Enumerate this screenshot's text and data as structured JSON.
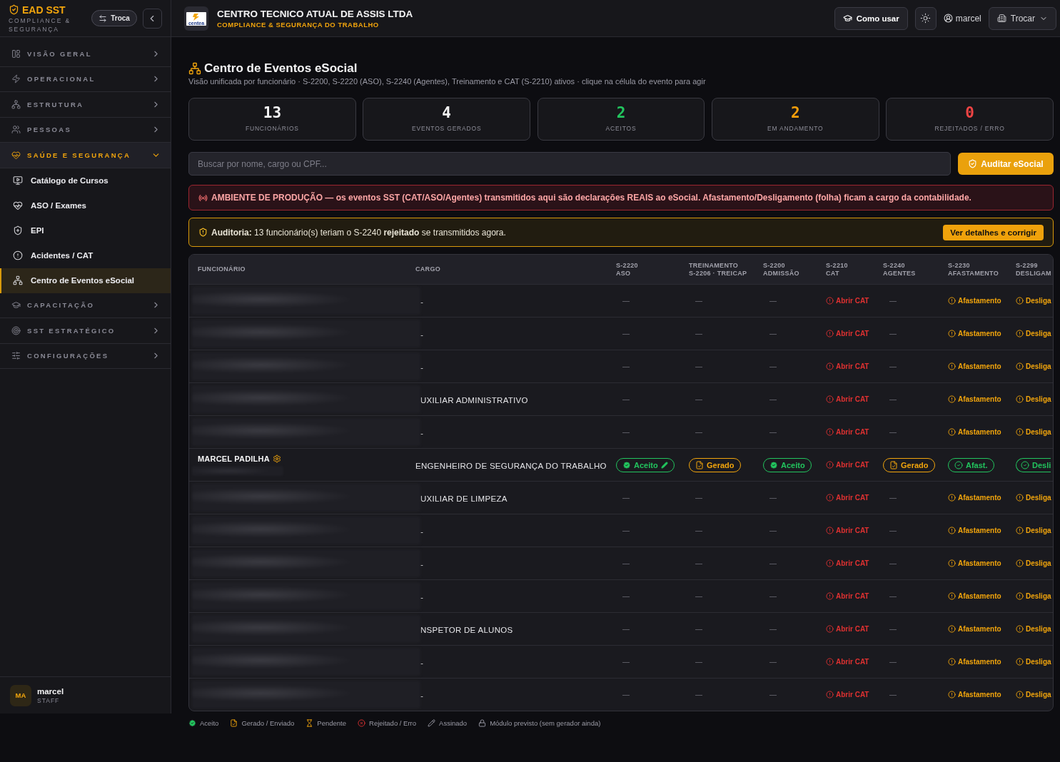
{
  "sidebar": {
    "brand": {
      "name": "EAD SST",
      "tagline": "COMPLIANCE & SEGURANÇA"
    },
    "switch_button": "Troca",
    "groups": [
      {
        "label": "VISÃO GERAL",
        "expanded": false
      },
      {
        "label": "OPERACIONAL",
        "expanded": false
      },
      {
        "label": "ESTRUTURA",
        "expanded": false
      },
      {
        "label": "PESSOAS",
        "expanded": false
      },
      {
        "label": "SAÚDE E SEGURANÇA",
        "expanded": true,
        "children": [
          {
            "label": "Catálogo de Cursos",
            "selected": false
          },
          {
            "label": "ASO / Exames",
            "selected": false
          },
          {
            "label": "EPI",
            "selected": false
          },
          {
            "label": "Acidentes / CAT",
            "selected": false
          },
          {
            "label": "Centro de Eventos eSocial",
            "selected": true
          }
        ]
      },
      {
        "label": "CAPACITAÇÃO",
        "expanded": false
      },
      {
        "label": "SST ESTRATÉGICO",
        "expanded": false
      },
      {
        "label": "CONFIGURAÇÕES",
        "expanded": false
      }
    ],
    "user": {
      "initials": "MA",
      "name": "marcel",
      "role": "STAFF"
    }
  },
  "header": {
    "logo_text": "centea",
    "company": "CENTRO TECNICO ATUAL DE ASSIS LTDA",
    "tagline": "COMPLIANCE & SEGURANÇA DO TRABALHO",
    "help_button": "Como usar",
    "user": "marcel",
    "switch_button": "Trocar"
  },
  "page": {
    "title": "Centro de Eventos eSocial",
    "subtitle": "Visão unificada por funcionário · S-2200, S-2220 (ASO), S-2240 (Agentes), Treinamento e CAT (S-2210) ativos · clique na célula do evento para agir"
  },
  "stats": [
    {
      "value": "13",
      "label": "FUNCIONÁRIOS",
      "color": "#f4f4f5"
    },
    {
      "value": "4",
      "label": "EVENTOS GERADOS",
      "color": "#f4f4f5"
    },
    {
      "value": "2",
      "label": "ACEITOS",
      "color": "#22c55e"
    },
    {
      "value": "2",
      "label": "EM ANDAMENTO",
      "color": "#f59e0b"
    },
    {
      "value": "0",
      "label": "REJEITADOS / ERRO",
      "color": "#ef4444"
    }
  ],
  "search": {
    "placeholder": "Buscar por nome, cargo ou CPF..."
  },
  "audit_button": "Auditar eSocial",
  "production_notice": "AMBIENTE DE PRODUÇÃO — os eventos SST (CAT/ASO/Agentes) transmitidos aqui são declarações REAIS ao eSocial. Afastamento/Desligamento (folha) ficam a cargo da contabilidade.",
  "audit_notice": {
    "text": "**Auditoria:** 13 funcionário(s) teriam o S-2240 **rejeitado** se transmitidos agora.",
    "button": "Ver detalhes e corrigir"
  },
  "table": {
    "columns": [
      {
        "title": "FUNCIONÁRIO"
      },
      {
        "title": "CARGO"
      },
      {
        "title": "S-2220",
        "subtitle": "ASO"
      },
      {
        "title": "TREINAMENTO",
        "subtitle": "S-2206 · TREICAP"
      },
      {
        "title": "S-2200",
        "subtitle": "ADMISSÃO"
      },
      {
        "title": "S-2210",
        "subtitle": "CAT"
      },
      {
        "title": "S-2240",
        "subtitle": "AGENTES"
      },
      {
        "title": "S-2230",
        "subtitle": "AFASTAMENTO"
      },
      {
        "title": "S-2299",
        "subtitle": "DESLIGAM"
      }
    ],
    "rows": [
      {
        "cells": [
          {
            "kind": "name",
            "redacted": true,
            "own_record": false
          },
          {
            "kind": "job",
            "text": "-"
          },
          {
            "kind": "empty",
            "text": "—"
          },
          {
            "kind": "empty",
            "text": "—"
          },
          {
            "kind": "empty",
            "text": "—"
          },
          {
            "kind": "alert-action",
            "text": "Abrir CAT"
          },
          {
            "kind": "empty",
            "text": "—"
          },
          {
            "kind": "action",
            "text": "Afastamento"
          },
          {
            "kind": "action",
            "text": "Desliga"
          }
        ]
      },
      {
        "cells": [
          {
            "kind": "name",
            "redacted": true,
            "own_record": false
          },
          {
            "kind": "job",
            "text": "-"
          },
          {
            "kind": "empty",
            "text": "—"
          },
          {
            "kind": "empty",
            "text": "—"
          },
          {
            "kind": "empty",
            "text": "—"
          },
          {
            "kind": "alert-action",
            "text": "Abrir CAT"
          },
          {
            "kind": "empty",
            "text": "—"
          },
          {
            "kind": "action",
            "text": "Afastamento"
          },
          {
            "kind": "action",
            "text": "Desliga"
          }
        ]
      },
      {
        "cells": [
          {
            "kind": "name",
            "redacted": true,
            "own_record": false
          },
          {
            "kind": "job",
            "text": "-"
          },
          {
            "kind": "empty",
            "text": "—"
          },
          {
            "kind": "empty",
            "text": "—"
          },
          {
            "kind": "empty",
            "text": "—"
          },
          {
            "kind": "alert-action",
            "text": "Abrir CAT"
          },
          {
            "kind": "empty",
            "text": "—"
          },
          {
            "kind": "action",
            "text": "Afastamento"
          },
          {
            "kind": "action",
            "text": "Desliga"
          }
        ]
      },
      {
        "cells": [
          {
            "kind": "name",
            "redacted": true,
            "own_record": false
          },
          {
            "kind": "job",
            "text": "UXILIAR ADMINISTRATIVO"
          },
          {
            "kind": "empty",
            "text": "—"
          },
          {
            "kind": "empty",
            "text": "—"
          },
          {
            "kind": "empty",
            "text": "—"
          },
          {
            "kind": "alert-action",
            "text": "Abrir CAT"
          },
          {
            "kind": "empty",
            "text": "—"
          },
          {
            "kind": "action",
            "text": "Afastamento"
          },
          {
            "kind": "action",
            "text": "Desliga"
          }
        ]
      },
      {
        "cells": [
          {
            "kind": "name",
            "redacted": true,
            "own_record": false
          },
          {
            "kind": "job",
            "text": "-"
          },
          {
            "kind": "empty",
            "text": "—"
          },
          {
            "kind": "empty",
            "text": "—"
          },
          {
            "kind": "empty",
            "text": "—"
          },
          {
            "kind": "alert-action",
            "text": "Abrir CAT"
          },
          {
            "kind": "empty",
            "text": "—"
          },
          {
            "kind": "action",
            "text": "Afastamento"
          },
          {
            "kind": "action",
            "text": "Desliga"
          }
        ]
      },
      {
        "cells": [
          {
            "kind": "name",
            "redacted": false,
            "own_record": true,
            "text": "MARCEL PADILHA"
          },
          {
            "kind": "job",
            "text": "ENGENHEIRO DE SEGURANÇA DO TRABALHO"
          },
          {
            "kind": "accepted",
            "text": "Aceito",
            "signed": true
          },
          {
            "kind": "generated",
            "text": "Gerado",
            "signed": false
          },
          {
            "kind": "accepted",
            "text": "Aceito",
            "signed": false
          },
          {
            "kind": "alert-action",
            "text": "Abrir CAT"
          },
          {
            "kind": "generated",
            "text": "Gerado",
            "signed": false
          },
          {
            "kind": "completed",
            "text": "Afast.",
            "signed": false
          },
          {
            "kind": "completed",
            "text": "Desli",
            "signed": false
          }
        ]
      },
      {
        "cells": [
          {
            "kind": "name",
            "redacted": true,
            "own_record": false
          },
          {
            "kind": "job",
            "text": "UXILIAR DE LIMPEZA"
          },
          {
            "kind": "empty",
            "text": "—"
          },
          {
            "kind": "empty",
            "text": "—"
          },
          {
            "kind": "empty",
            "text": "—"
          },
          {
            "kind": "alert-action",
            "text": "Abrir CAT"
          },
          {
            "kind": "empty",
            "text": "—"
          },
          {
            "kind": "action",
            "text": "Afastamento"
          },
          {
            "kind": "action",
            "text": "Desliga"
          }
        ]
      },
      {
        "cells": [
          {
            "kind": "name",
            "redacted": true,
            "own_record": false
          },
          {
            "kind": "job",
            "text": "-"
          },
          {
            "kind": "empty",
            "text": "—"
          },
          {
            "kind": "empty",
            "text": "—"
          },
          {
            "kind": "empty",
            "text": "—"
          },
          {
            "kind": "alert-action",
            "text": "Abrir CAT"
          },
          {
            "kind": "empty",
            "text": "—"
          },
          {
            "kind": "action",
            "text": "Afastamento"
          },
          {
            "kind": "action",
            "text": "Desliga"
          }
        ]
      },
      {
        "cells": [
          {
            "kind": "name",
            "redacted": true,
            "own_record": false
          },
          {
            "kind": "job",
            "text": "-"
          },
          {
            "kind": "empty",
            "text": "—"
          },
          {
            "kind": "empty",
            "text": "—"
          },
          {
            "kind": "empty",
            "text": "—"
          },
          {
            "kind": "alert-action",
            "text": "Abrir CAT"
          },
          {
            "kind": "empty",
            "text": "—"
          },
          {
            "kind": "action",
            "text": "Afastamento"
          },
          {
            "kind": "action",
            "text": "Desliga"
          }
        ]
      },
      {
        "cells": [
          {
            "kind": "name",
            "redacted": true,
            "own_record": false
          },
          {
            "kind": "job",
            "text": "-"
          },
          {
            "kind": "empty",
            "text": "—"
          },
          {
            "kind": "empty",
            "text": "—"
          },
          {
            "kind": "empty",
            "text": "—"
          },
          {
            "kind": "alert-action",
            "text": "Abrir CAT"
          },
          {
            "kind": "empty",
            "text": "—"
          },
          {
            "kind": "action",
            "text": "Afastamento"
          },
          {
            "kind": "action",
            "text": "Desliga"
          }
        ]
      },
      {
        "cells": [
          {
            "kind": "name",
            "redacted": true,
            "own_record": false
          },
          {
            "kind": "job",
            "text": "NSPETOR DE ALUNOS"
          },
          {
            "kind": "empty",
            "text": "—"
          },
          {
            "kind": "empty",
            "text": "—"
          },
          {
            "kind": "empty",
            "text": "—"
          },
          {
            "kind": "alert-action",
            "text": "Abrir CAT"
          },
          {
            "kind": "empty",
            "text": "—"
          },
          {
            "kind": "action",
            "text": "Afastamento"
          },
          {
            "kind": "action",
            "text": "Desliga"
          }
        ]
      },
      {
        "cells": [
          {
            "kind": "name",
            "redacted": true,
            "own_record": false
          },
          {
            "kind": "job",
            "text": "-"
          },
          {
            "kind": "empty",
            "text": "—"
          },
          {
            "kind": "empty",
            "text": "—"
          },
          {
            "kind": "empty",
            "text": "—"
          },
          {
            "kind": "alert-action",
            "text": "Abrir CAT"
          },
          {
            "kind": "empty",
            "text": "—"
          },
          {
            "kind": "action",
            "text": "Afastamento"
          },
          {
            "kind": "action",
            "text": "Desliga"
          }
        ]
      },
      {
        "cells": [
          {
            "kind": "name",
            "redacted": true,
            "own_record": false
          },
          {
            "kind": "job",
            "text": "-"
          },
          {
            "kind": "empty",
            "text": "—"
          },
          {
            "kind": "empty",
            "text": "—"
          },
          {
            "kind": "empty",
            "text": "—"
          },
          {
            "kind": "alert-action",
            "text": "Abrir CAT"
          },
          {
            "kind": "empty",
            "text": "—"
          },
          {
            "kind": "action",
            "text": "Afastamento"
          },
          {
            "kind": "action",
            "text": "Desliga"
          }
        ]
      }
    ]
  },
  "legend": [
    {
      "kind": "accepted",
      "label": "Aceito"
    },
    {
      "kind": "generated",
      "label": "Gerado / Enviado"
    },
    {
      "kind": "pending",
      "label": "Pendente"
    },
    {
      "kind": "rejected",
      "label": "Rejeitado / Erro"
    },
    {
      "kind": "signed",
      "label": "Assinado"
    },
    {
      "kind": "planned",
      "label": "Módulo previsto (sem gerador ainda)"
    }
  ]
}
